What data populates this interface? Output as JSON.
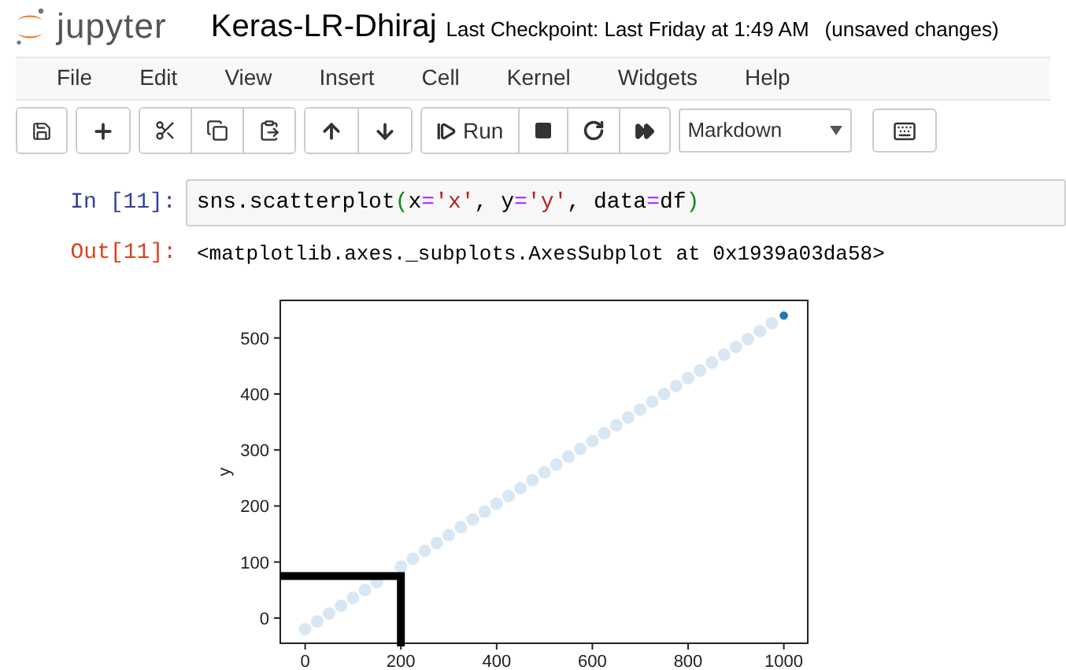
{
  "header": {
    "logo_text": "jupyter",
    "notebook_name": "Keras-LR-Dhiraj",
    "checkpoint": "Last Checkpoint: Last Friday at 1:49 AM",
    "save_status": "(unsaved changes)"
  },
  "menu": [
    "File",
    "Edit",
    "View",
    "Insert",
    "Cell",
    "Kernel",
    "Widgets",
    "Help"
  ],
  "toolbar": {
    "run_label": "Run",
    "cell_type": "Markdown"
  },
  "cell": {
    "prompt": "In [11]:",
    "code": "sns.scatterplot(x='x', y='y', data=df)",
    "output_prompt": "Out[11]:",
    "output": "<matplotlib.axes._subplots.AxesSubplot at 0x1939a03da58>",
    "chart_data": {
      "type": "scatter",
      "ylabel": "y",
      "xlim": [
        -52,
        1050
      ],
      "ylim": [
        -45,
        567
      ],
      "xticks": [
        0,
        200,
        400,
        600,
        800,
        1000
      ],
      "yticks": [
        0,
        100,
        200,
        300,
        400,
        500
      ],
      "x": [
        0,
        25,
        50,
        75,
        100,
        125,
        150,
        200,
        225,
        250,
        275,
        300,
        325,
        350,
        375,
        400,
        425,
        450,
        475,
        500,
        525,
        550,
        575,
        600,
        625,
        650,
        675,
        700,
        725,
        750,
        775,
        800,
        825,
        850,
        875,
        900,
        925,
        950,
        975,
        1000
      ],
      "series": [
        {
          "color": "#d8e7f2",
          "values": [
            -20,
            -6,
            8,
            22,
            36,
            50,
            64,
            92,
            106,
            120,
            134,
            148,
            162,
            176,
            190,
            204,
            218,
            232,
            246,
            260,
            274,
            288,
            302,
            316,
            330,
            344,
            358,
            372,
            386,
            400,
            414,
            428,
            442,
            456,
            470,
            484,
            498,
            512,
            526,
            null
          ]
        },
        {
          "color": "#1f77b4",
          "values": [
            null,
            null,
            null,
            null,
            null,
            null,
            null,
            null,
            null,
            null,
            null,
            null,
            null,
            null,
            null,
            null,
            null,
            null,
            null,
            null,
            null,
            null,
            null,
            null,
            null,
            null,
            null,
            null,
            null,
            null,
            null,
            null,
            null,
            null,
            null,
            null,
            null,
            null,
            null,
            540
          ]
        }
      ]
    }
  }
}
